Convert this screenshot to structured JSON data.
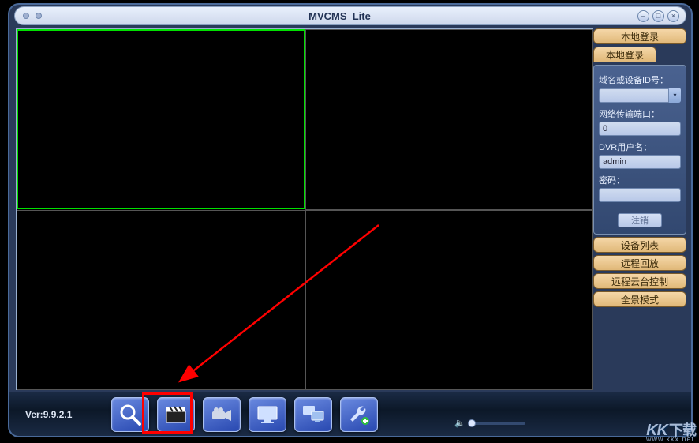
{
  "app_title": "MVCMS_Lite",
  "version_label": "Ver: ",
  "version": "9.9.2.1",
  "sidebar": {
    "local_login_btn": "本地登录",
    "local_login_tab": "本地登录",
    "device_list_btn": "设备列表",
    "remote_playback_btn": "远程回放",
    "ptz_control_btn": "远程云台控制",
    "panorama_mode_btn": "全景模式"
  },
  "login_form": {
    "domain_label": "域名或设备ID号：",
    "domain_value": "",
    "port_label": "网络传输端口：",
    "port_value": "0",
    "user_label": "DVR用户名：",
    "user_value": "admin",
    "pwd_label": "密码：",
    "pwd_value": "",
    "logout_label": "注销"
  },
  "toolbar_icons": {
    "search": "search-icon",
    "record": "clapperboard-icon",
    "camera": "camcorder-icon",
    "monitor1": "monitor-icon",
    "monitor2": "monitor-group-icon",
    "settings": "wrench-plus-icon"
  },
  "watermark": {
    "logo": "KK下载",
    "sub": "www.kkx.net"
  }
}
